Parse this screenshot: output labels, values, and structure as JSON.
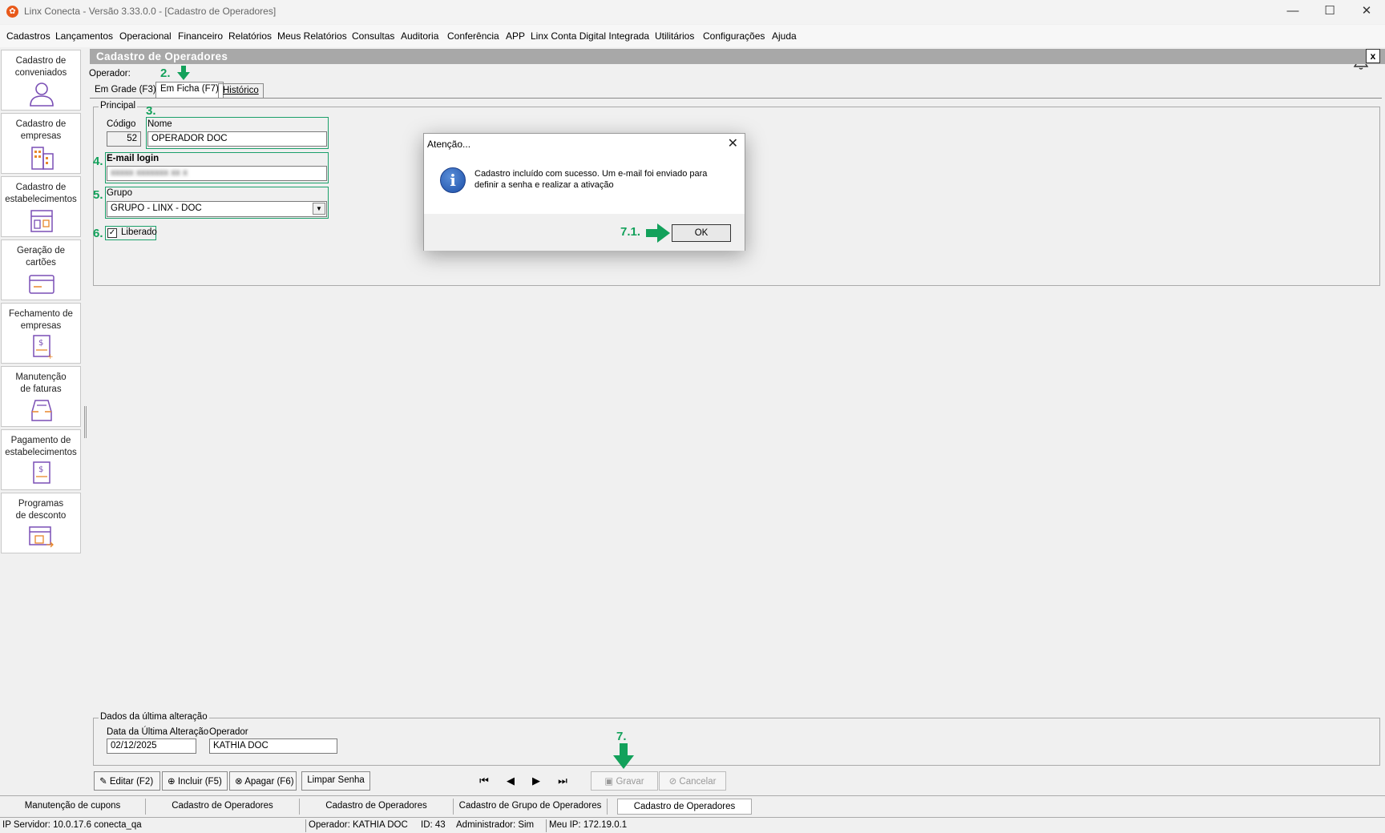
{
  "window": {
    "title": "Linx Conecta - Versão 3.33.0.0 - [Cadastro de Operadores]",
    "app_icon": "linx-logo-icon",
    "controls": [
      "minimize",
      "maximize",
      "close"
    ]
  },
  "menu": {
    "items": [
      "Cadastros",
      "Lançamentos",
      "Operacional",
      "Financeiro",
      "Relatórios",
      "Meus Relatórios",
      "Consultas",
      "Auditoria",
      "Conferência",
      "APP",
      "Linx Conta Digital Integrada",
      "Utilitários",
      "Configurações",
      "Ajuda"
    ],
    "bell_icon": "bell-icon"
  },
  "sidebar": {
    "items": [
      {
        "label": "Cadastro de conveniados",
        "icon": "person-icon"
      },
      {
        "label": "Cadastro de empresas",
        "icon": "building-icon"
      },
      {
        "label": "Cadastro de estabelecimentos",
        "icon": "store-icon"
      },
      {
        "label": "Geração de cartões",
        "icon": "card-icon"
      },
      {
        "label": "Fechamento de empresas",
        "icon": "invoice-icon"
      },
      {
        "label": "Manutenção de faturas",
        "icon": "inbox-icon"
      },
      {
        "label": "Pagamento de estabelecimentos",
        "icon": "payment-icon"
      },
      {
        "label": "Programas de desconto",
        "icon": "discount-icon"
      }
    ]
  },
  "form": {
    "title": "Cadastro de Operadores",
    "close": "x",
    "operator_label": "Operador:",
    "tabs": [
      "Em Grade (F3)",
      "Em Ficha (F7)",
      "Histórico"
    ],
    "principal_label": "Principal",
    "codigo_label": "Código",
    "codigo_value": "52",
    "nome_label": "Nome",
    "nome_value": "OPERADOR DOC",
    "email_label": "E-mail login",
    "email_value": "xxxxx xxxxxxx xx x",
    "grupo_label": "Grupo",
    "grupo_value": "GRUPO - LINX - DOC",
    "liberado_label": "Liberado",
    "liberado_checked": true,
    "last_change_label": "Dados da última alteração",
    "last_change_date_label": "Data da Última Alteração",
    "last_change_date_value": "02/12/2025",
    "last_change_operator_label": "Operador",
    "last_change_operator_value": "KATHIA DOC"
  },
  "steps": {
    "s2": "2.",
    "s3": "3.",
    "s4": "4.",
    "s5": "5.",
    "s6": "6.",
    "s7": "7.",
    "s71": "7.1."
  },
  "toolbar": {
    "editar": "Editar (F2)",
    "incluir": "Incluir (F5)",
    "apagar": "Apagar (F6)",
    "limpar": "Limpar Senha",
    "gravar": "Gravar",
    "cancelar": "Cancelar"
  },
  "taskbar": {
    "items": [
      "Manutenção de cupons",
      "Cadastro de Operadores",
      "Cadastro de Operadores",
      "Cadastro de Grupo de Operadores",
      "Cadastro de Operadores"
    ],
    "active_index": 4
  },
  "statusbar": {
    "server": "IP Servidor: 10.0.17.6 conecta_qa",
    "operator": "Operador: KATHIA DOC",
    "id": "ID: 43",
    "admin": "Administrador: Sim",
    "ip": "Meu IP: 172.19.0.1"
  },
  "dialog": {
    "title": "Atenção...",
    "message": "Cadastro incluído com sucesso. Um e-mail foi enviado para definir a senha e realizar a ativação",
    "ok": "OK",
    "icon": "info-icon"
  },
  "colors": {
    "accent_green": "#13a15b",
    "title_gray": "#a8a8a8",
    "brand_orange": "#e8591a"
  }
}
